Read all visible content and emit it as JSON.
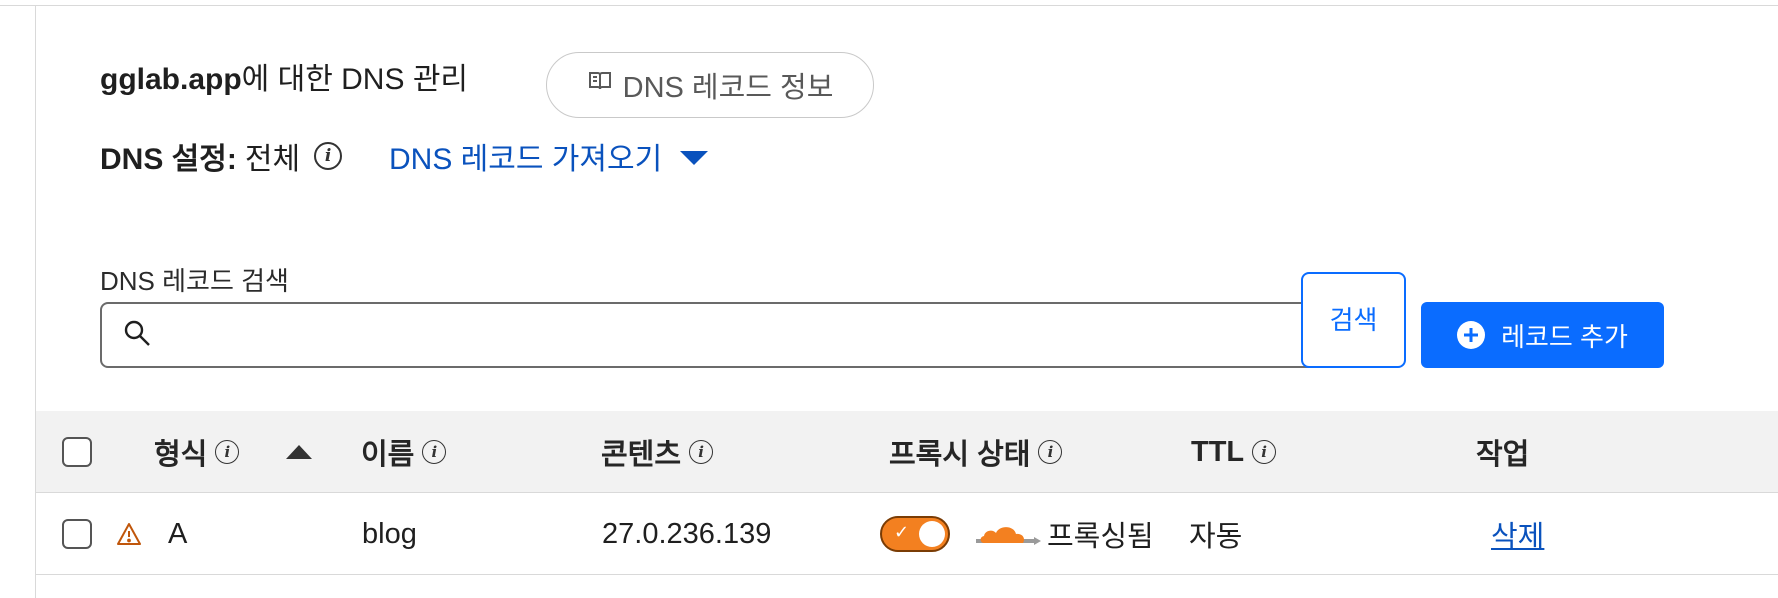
{
  "header": {
    "domain": "gglab.app",
    "title_suffix": "에 대한 DNS 관리",
    "info_button_label": "DNS 레코드 정보",
    "settings_label": "DNS 설정:",
    "settings_value": "전체",
    "import_link_label": "DNS 레코드 가져오기"
  },
  "search": {
    "label": "DNS 레코드 검색",
    "value": "",
    "placeholder": "",
    "button_label": "검색",
    "add_button_label": "레코드 추가"
  },
  "table": {
    "columns": {
      "type": "형식",
      "name": "이름",
      "content": "콘텐츠",
      "proxy": "프록시 상태",
      "ttl": "TTL",
      "actions": "작업"
    },
    "rows": [
      {
        "type": "A",
        "name": "blog",
        "content": "27.0.236.139",
        "proxy_status": "프록싱됨",
        "proxy_enabled": true,
        "ttl": "자동",
        "action": "삭제",
        "warning": true
      }
    ]
  },
  "colors": {
    "accent": "#0a6cff",
    "link": "#0a52bd",
    "proxy_orange": "#f38020",
    "warning": "#c0560b"
  },
  "icons": [
    "book-icon",
    "info-icon",
    "caret-down-icon",
    "search-icon",
    "plus-circle-icon",
    "sort-up-icon",
    "warning-icon",
    "cloud-proxy-icon",
    "check-icon"
  ]
}
